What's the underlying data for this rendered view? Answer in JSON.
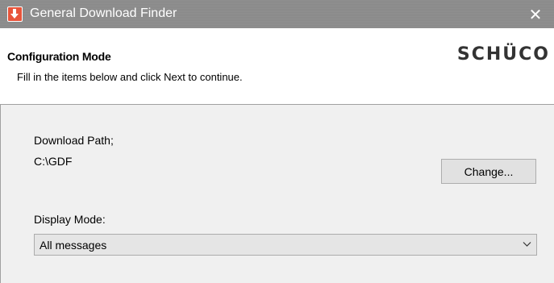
{
  "window": {
    "title": "General Download Finder",
    "close_glyph": "✕"
  },
  "header": {
    "title": "Configuration Mode",
    "subtitle": "Fill in the items below and click Next to continue.",
    "logo_text": "SCHÜCO"
  },
  "form": {
    "download_path_label": "Download Path;",
    "download_path_value": "C:\\GDF",
    "change_button_label": "Change...",
    "display_mode_label": "Display Mode:",
    "display_mode_value": "All messages"
  },
  "icons": {
    "app": "download-arrow-icon",
    "close": "close-icon",
    "dropdown": "chevron-down-icon"
  },
  "colors": {
    "titlebar": "#8c8c8c",
    "app_icon": "#e8553b",
    "button_face": "#e1e1e1",
    "body_bg": "#f0f0f0"
  }
}
